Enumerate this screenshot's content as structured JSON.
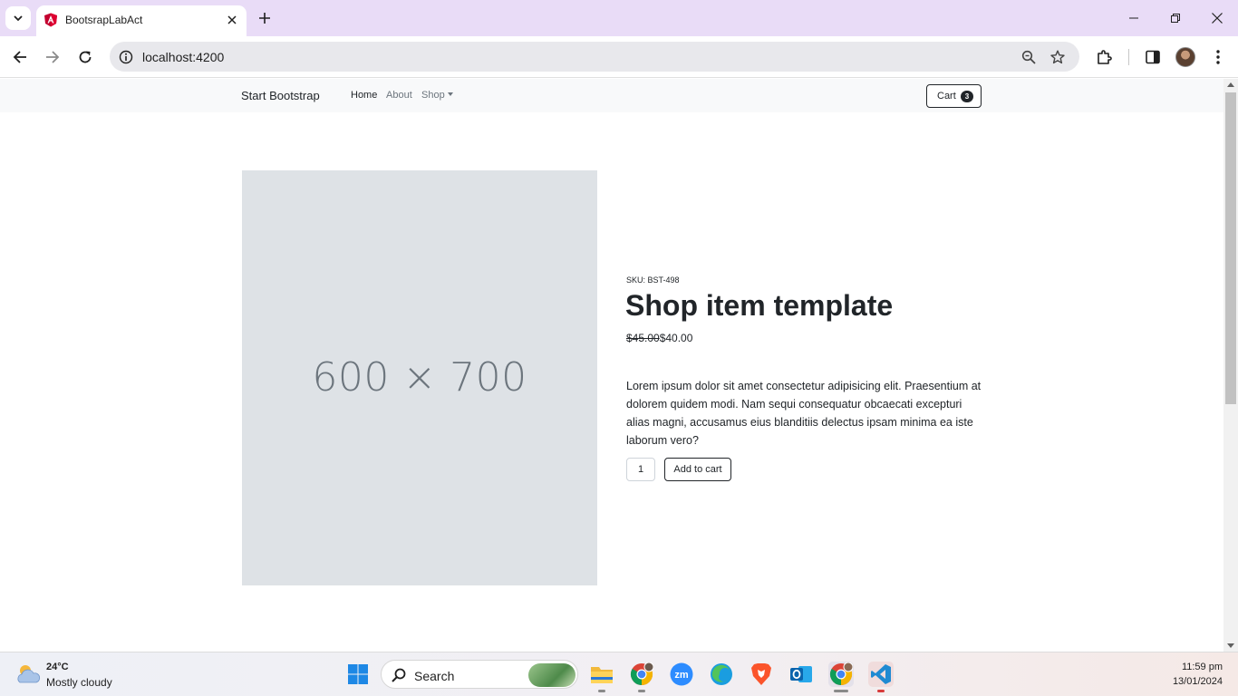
{
  "browser": {
    "tab_title": "BootsrapLabAct",
    "url": "localhost:4200"
  },
  "navbar": {
    "brand": "Start Bootstrap",
    "links": [
      "Home",
      "About",
      "Shop"
    ],
    "cart_label": "Cart",
    "cart_count": "3"
  },
  "product": {
    "image_placeholder": "600 × 700",
    "sku": "SKU: BST-498",
    "title": "Shop item template",
    "old_price": "$45.00",
    "price": "$40.00",
    "description": "Lorem ipsum dolor sit amet consectetur adipisicing elit. Praesentium at dolorem quidem modi. Nam sequi consequatur obcaecati excepturi alias magni, accusamus eius blanditiis delectus ipsam minima ea iste laborum vero?",
    "quantity": "1",
    "add_to_cart_label": "Add to cart"
  },
  "taskbar": {
    "weather_temp": "24°C",
    "weather_condition": "Mostly cloudy",
    "search_label": "Search",
    "time": "11:59 pm",
    "date": "13/01/2024"
  },
  "colors": {
    "tab_strip": "#e9dcf7",
    "navbar_bg": "#f8f9fa",
    "placeholder_bg": "#dee2e6",
    "text_dark": "#212529",
    "text_muted": "#6c757d"
  },
  "icons": [
    "tab-search-icon",
    "angular-logo-icon",
    "close-icon",
    "plus-icon",
    "minimize-icon",
    "restore-icon",
    "back-icon",
    "forward-icon",
    "reload-icon",
    "info-icon",
    "zoom-icon",
    "star-icon",
    "extensions-icon",
    "side-panel-icon",
    "menu-dots-icon",
    "weather-icon",
    "windows-start-icon",
    "search-icon",
    "file-explorer-icon",
    "chrome-icon",
    "zoom-app-icon",
    "edge-icon",
    "brave-icon",
    "outlook-icon",
    "vscode-icon"
  ]
}
